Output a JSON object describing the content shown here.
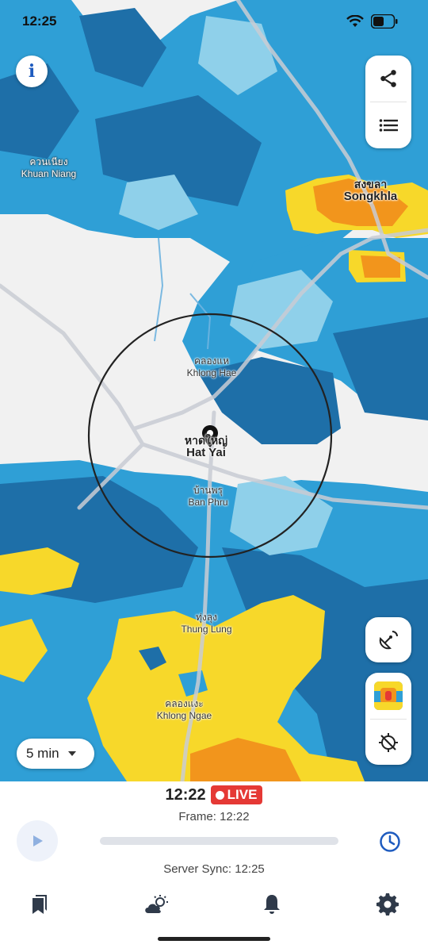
{
  "status_bar": {
    "time": "12:25",
    "icons": [
      "wifi-icon",
      "battery-icon"
    ]
  },
  "map": {
    "labels": [
      {
        "th": "ควนเนียง",
        "en": "Khuan Niang"
      },
      {
        "th": "สงขลา",
        "en": "Songkhla"
      },
      {
        "th": "คลองแห",
        "en": "Khlong Hae"
      },
      {
        "th": "หาดใหญ่",
        "en": "Hat Yai"
      },
      {
        "th": "บ้านพรุ",
        "en": "Ban Phru"
      },
      {
        "th": "ทุ่งลุง",
        "en": "Thung Lung"
      },
      {
        "th": "คลองแงะ",
        "en": "Khlong Ngae"
      }
    ],
    "radius_circle": true,
    "location_pin": "location-pin-icon"
  },
  "controls": {
    "info_icon": "info-icon",
    "share_icon": "share-icon",
    "layers_icon": "list-icon",
    "satellite_icon": "satellite-dish-icon",
    "map_style_icon": "map-style-thumbnail-icon",
    "locate_icon": "locate-off-icon",
    "interval_label": "5 min"
  },
  "player": {
    "current_time": "12:22",
    "live_label": "LIVE",
    "frame_label": "Frame: 12:22",
    "server_sync": "Server Sync: 12:25",
    "progress": 0
  },
  "navbar": {
    "items": [
      "bookmarks-icon",
      "weather-icon",
      "notifications-icon",
      "settings-icon"
    ]
  },
  "colors": {
    "live_red": "#e53935",
    "accent_blue": "#1e5bbf",
    "radar_light": "#8fd0ea",
    "radar_mid": "#2f9fd6",
    "radar_dark": "#1e6fa8",
    "radar_yellow": "#f7d82a",
    "radar_orange": "#f2951c"
  }
}
